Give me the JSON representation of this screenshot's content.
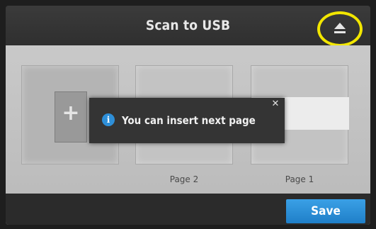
{
  "header": {
    "title": "Scan to USB",
    "eject_icon": "eject-icon",
    "highlight_color": "#f2e600"
  },
  "pages": [
    {
      "kind": "add",
      "icon": "add-page-icon"
    },
    {
      "kind": "page",
      "label": "Page 2"
    },
    {
      "kind": "page",
      "label": "Page 1"
    }
  ],
  "toast": {
    "icon": "info-icon",
    "message": "You can insert next page",
    "close_icon": "close-icon"
  },
  "footer": {
    "save_label": "Save",
    "accent": "#2e8fd8"
  }
}
